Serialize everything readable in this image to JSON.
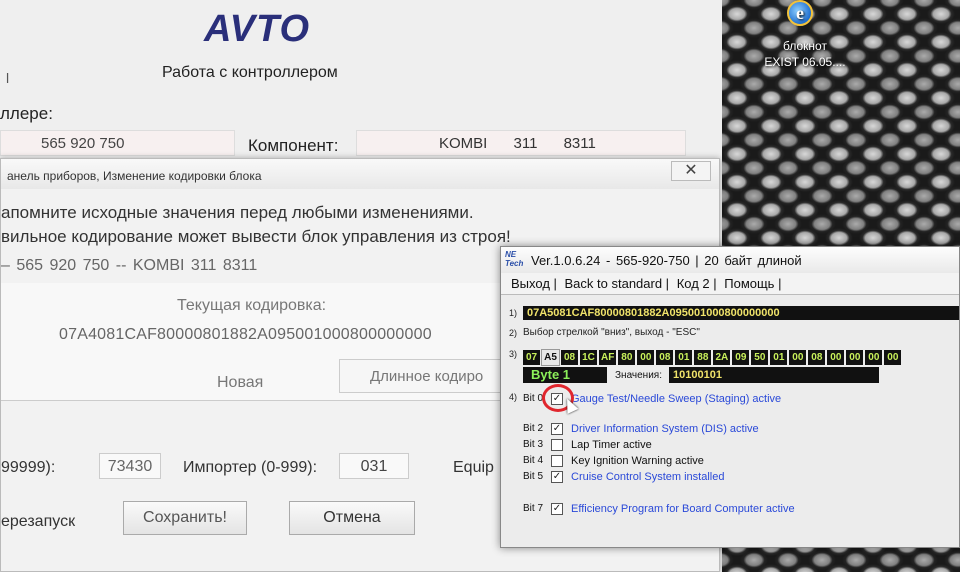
{
  "desktop": {
    "notepad_label": "блокнот",
    "exist_label": "EXIST 06.05...."
  },
  "main_window": {
    "title": "AVTO",
    "subtitle": "Работа с контроллером",
    "left_mark": "l",
    "controller_label": "ллере:",
    "controller_number": "565 920 750",
    "component_label": "Компонент:",
    "component_value": "KOMBI 311 8311"
  },
  "coding_dialog": {
    "title": "анель приборов, Изменение кодировки блока",
    "close_glyph": "✕",
    "warning_1": "апомните исходные значения перед любыми изменениями.",
    "warning_2": "вильное кодирование может вывести блок управления из строя!",
    "summary": "– 565 920 750 -- KOMBI 311 8311",
    "current_coding_label": "Текущая кодировка:",
    "current_coding": "07A4081CAF80000801882A095001000800000000",
    "new_label": "Новая",
    "long_coding_button": "Длинное кодиро",
    "workshop_label": "99999):",
    "workshop_code": "73430",
    "importer_label": "Импортер (0-999):",
    "importer_code": "031",
    "equip_label": "Equip",
    "restart_label": "ерезапуск",
    "save_button": "Сохранить!",
    "cancel_button": "Отмена"
  },
  "bit_window": {
    "logo": "NE\nTech",
    "title": "Ver.1.0.6.24 - 565-920-750 | 20 байт длиной",
    "menu": [
      "Выход |",
      "Back to standard |",
      "Код 2 |",
      "Помощь |"
    ],
    "row_numbers": [
      "1)",
      "2)",
      "3)",
      "4)"
    ],
    "full_coding": "07A5081CAF80000801882A095001000800000000",
    "hint": "Выбор стрелкой \"вниз\", выход - \"ESC\"",
    "bytes": [
      "07",
      "A5",
      "08",
      "1C",
      "AF",
      "80",
      "00",
      "08",
      "01",
      "88",
      "2A",
      "09",
      "50",
      "01",
      "00",
      "08",
      "00",
      "00",
      "00",
      "00"
    ],
    "byte_label": "Byte 1",
    "value_label": "Значения:",
    "value": "10100101",
    "bits": [
      {
        "label": "Bit 0",
        "checked": true,
        "text": "Gauge Test/Needle Sweep (Staging) active",
        "style": "blue"
      },
      {
        "label": "Bit 2",
        "checked": true,
        "text": "Driver Information System (DIS) active",
        "style": "blue"
      },
      {
        "label": "Bit 3",
        "checked": false,
        "text": "Lap Timer active",
        "style": "dark"
      },
      {
        "label": "Bit 4",
        "checked": false,
        "text": "Key Ignition Warning active",
        "style": "dark"
      },
      {
        "label": "Bit 5",
        "checked": true,
        "text": "Cruise Control System installed",
        "style": "blue"
      },
      {
        "label": "Bit 7",
        "checked": true,
        "text": "Efficiency Program for Board Computer active",
        "style": "blue"
      }
    ],
    "check_glyph": "✓"
  }
}
